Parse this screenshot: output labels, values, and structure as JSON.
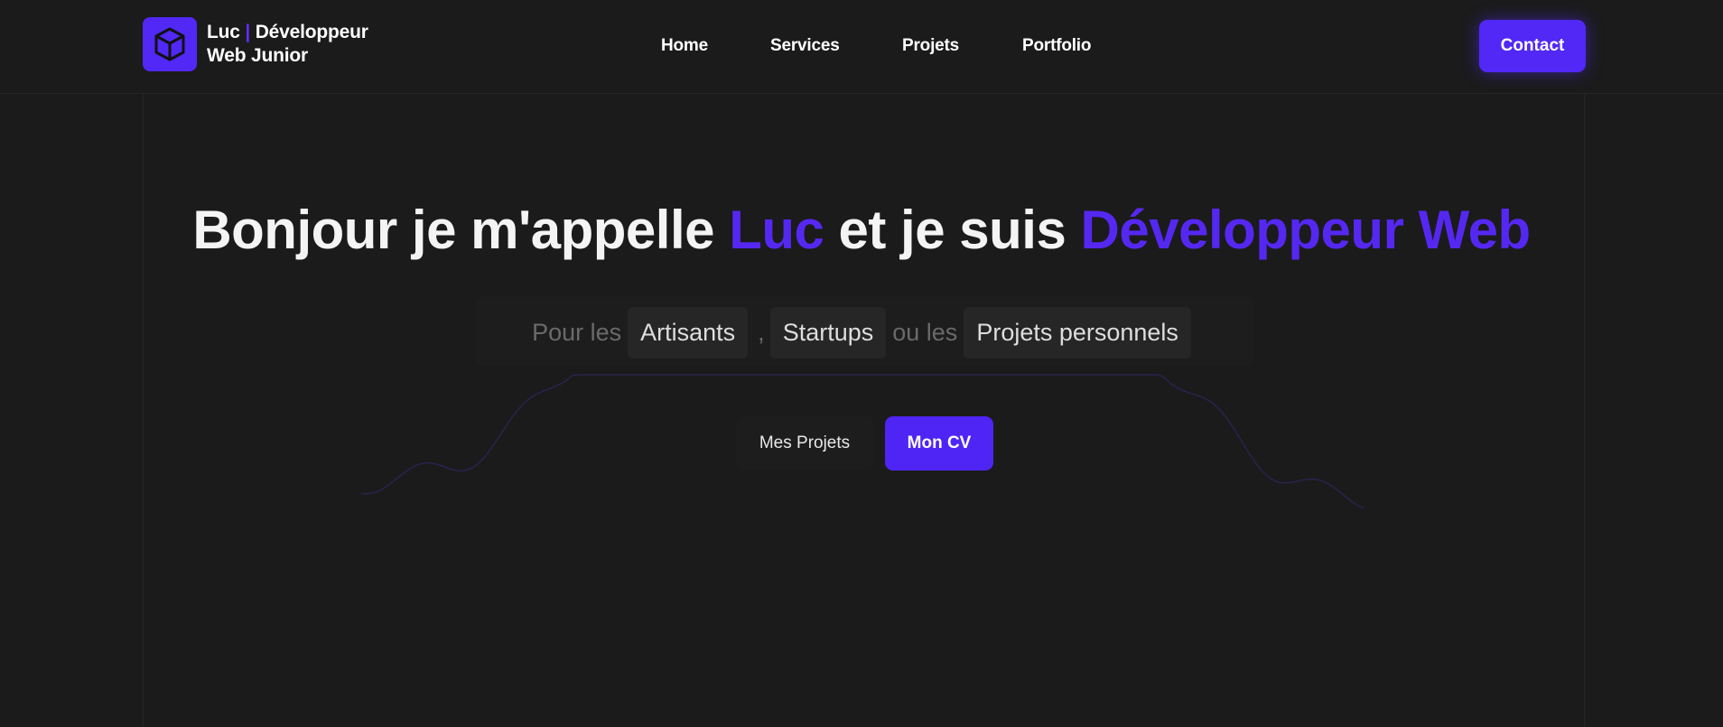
{
  "brand": {
    "name": "Luc",
    "separator": "|",
    "role_line1": "Développeur",
    "role_line2": "Web Junior",
    "logo_icon": "cube-icon"
  },
  "nav": {
    "items": [
      "Home",
      "Services",
      "Projets",
      "Portfolio"
    ]
  },
  "header": {
    "contact_label": "Contact"
  },
  "hero": {
    "title_part1": "Bonjour je m'appelle ",
    "title_name": "Luc",
    "title_part2": " et je suis ",
    "title_role": "Développeur Web",
    "tagline_prefix": "Pour les",
    "tagline_chip1": "Artisants",
    "tagline_comma": ",",
    "tagline_chip2": "Startups",
    "tagline_middle": "ou les",
    "tagline_chip3": "Projets personnels",
    "btn_projects": "Mes Projets",
    "btn_cv": "Mon CV"
  },
  "colors": {
    "background": "#1b1b1b",
    "accent": "#5128f5",
    "text": "#ffffff",
    "muted": "#6a6a6a"
  }
}
